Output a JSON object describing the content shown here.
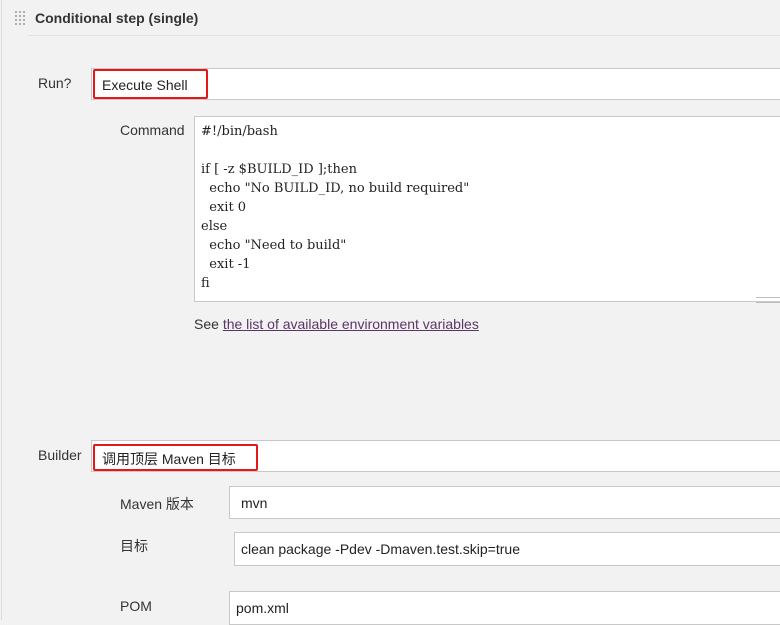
{
  "step": {
    "title": "Conditional step (single)"
  },
  "run": {
    "label": "Run?",
    "value": "Execute Shell"
  },
  "command": {
    "label": "Command",
    "lines": [
      "#!/bin/bash",
      "",
      "if [ -z $BUILD_ID ];then",
      "  echo \"No BUILD_ID, no build required\"",
      "  exit 0",
      "else",
      "  echo \"Need to build\"",
      "  exit -1",
      "fi"
    ],
    "help_prefix": "See ",
    "help_link": "the list of available environment variables"
  },
  "builder": {
    "label": "Builder",
    "value": "调用顶层 Maven 目标",
    "maven_version_label": "Maven 版本",
    "maven_version_value": "mvn",
    "goals_label": "目标",
    "goals_value": "clean package -Pdev -Dmaven.test.skip=true",
    "pom_label": "POM",
    "pom_value": "pom.xml"
  },
  "colors": {
    "highlight": "#e41818",
    "link": "#5c3566",
    "background": "#f2f2f2"
  }
}
